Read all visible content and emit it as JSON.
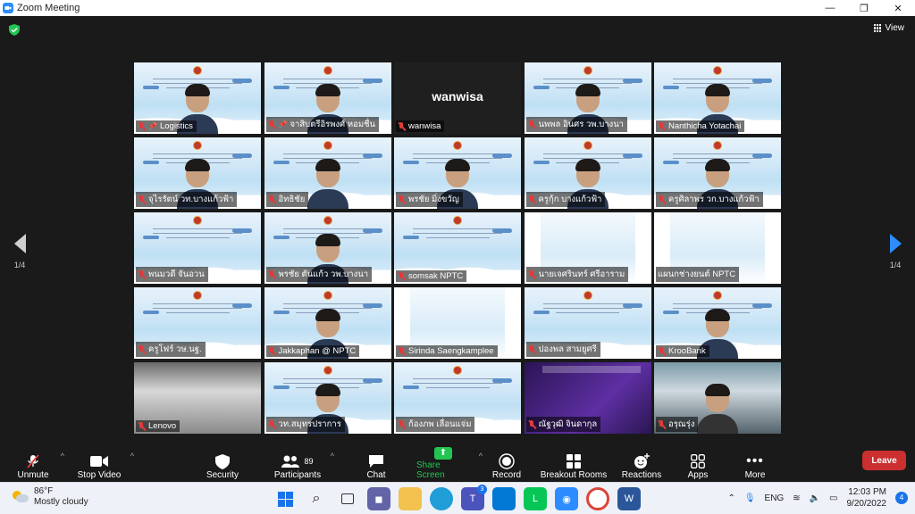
{
  "window": {
    "title": "Zoom Meeting",
    "controls": [
      "—",
      "❐",
      "✕"
    ]
  },
  "header": {
    "view_label": "View"
  },
  "pagination": {
    "left": "1/4",
    "right": "1/4"
  },
  "colors": {
    "accent": "#2D8CFF",
    "active_speaker": "#b5e61d",
    "muted": "#e03b3b",
    "leave": "#cc2f2f",
    "share": "#23c552"
  },
  "participants": [
    {
      "name": "Logistics",
      "pinned": true,
      "kind": "slide-person"
    },
    {
      "name": "จาสิบตรีอิรพงศ์ หอมชื่น",
      "pinned": true,
      "kind": "slide-person"
    },
    {
      "name": "wanwisa",
      "pinned": false,
      "kind": "name-only",
      "center_name": "wanwisa"
    },
    {
      "name": "นพพล อินศร วพ.บางนา",
      "pinned": false,
      "kind": "slide-person",
      "active": true
    },
    {
      "name": "Nanthicha Yotachai",
      "pinned": false,
      "kind": "slide-person"
    },
    {
      "name": "จุไรรัตน์ วท.บางแก้วฟ้า",
      "pinned": false,
      "kind": "slide-person"
    },
    {
      "name": "อิทธิชัย",
      "pinned": false,
      "kind": "slide-person"
    },
    {
      "name": "พรชัย มิ่งขวัญ",
      "pinned": false,
      "kind": "slide-person"
    },
    {
      "name": "ครูกุ้ก บางแก้วฟ้า",
      "pinned": false,
      "kind": "slide-person"
    },
    {
      "name": "ครูศิลาพร วก.บางแก้วฟ้า",
      "pinned": false,
      "kind": "slide-person"
    },
    {
      "name": "พนมวดี จันอวน",
      "pinned": false,
      "kind": "slide"
    },
    {
      "name": "พรชัย ตันแก้ว วพ.บางนา",
      "pinned": false,
      "kind": "slide-person"
    },
    {
      "name": "somsak NPTC",
      "pinned": false,
      "kind": "slide"
    },
    {
      "name": "นายเจศรินทร์ ศรีอาราม",
      "pinned": false,
      "kind": "pslide"
    },
    {
      "name": "แผนกช่างยนต์ NPTC",
      "pinned": false,
      "kind": "pslide",
      "no_mic": true
    },
    {
      "name": "ครูโฟร์ วษ.นฐ.",
      "pinned": false,
      "kind": "slide"
    },
    {
      "name": "Jakkaphan @ NPTC",
      "pinned": false,
      "kind": "slide-person"
    },
    {
      "name": "Sirinda Saengkamplee",
      "pinned": false,
      "kind": "pslide"
    },
    {
      "name": "ปองพล สามยูศรี",
      "pinned": false,
      "kind": "slide"
    },
    {
      "name": "KrooBank",
      "pinned": false,
      "kind": "slide-person"
    },
    {
      "name": "Lenovo",
      "pinned": false,
      "kind": "photo"
    },
    {
      "name": "วท.สมุทรปราการ",
      "pinned": false,
      "kind": "slide-person"
    },
    {
      "name": "ก้องภพ เลื่อนแจ่ม",
      "pinned": false,
      "kind": "slide"
    },
    {
      "name": "ณัฐวุฒิ จินดากุล",
      "pinned": false,
      "kind": "purple"
    },
    {
      "name": "อรุณรุ่ง",
      "pinned": false,
      "kind": "room"
    }
  ],
  "toolbar": {
    "unmute": "Unmute",
    "stop_video": "Stop Video",
    "security": "Security",
    "participants": "Participants",
    "participants_count": "89",
    "chat": "Chat",
    "share_screen": "Share Screen",
    "record": "Record",
    "breakout_rooms": "Breakout Rooms",
    "reactions": "Reactions",
    "apps": "Apps",
    "more": "More",
    "leave": "Leave"
  },
  "taskbar": {
    "weather_temp": "86°F",
    "weather_desc": "Mostly cloudy",
    "teams_badge": "3",
    "language": "ENG",
    "time": "12:03 PM",
    "date": "9/20/2022",
    "notifications": "4"
  }
}
